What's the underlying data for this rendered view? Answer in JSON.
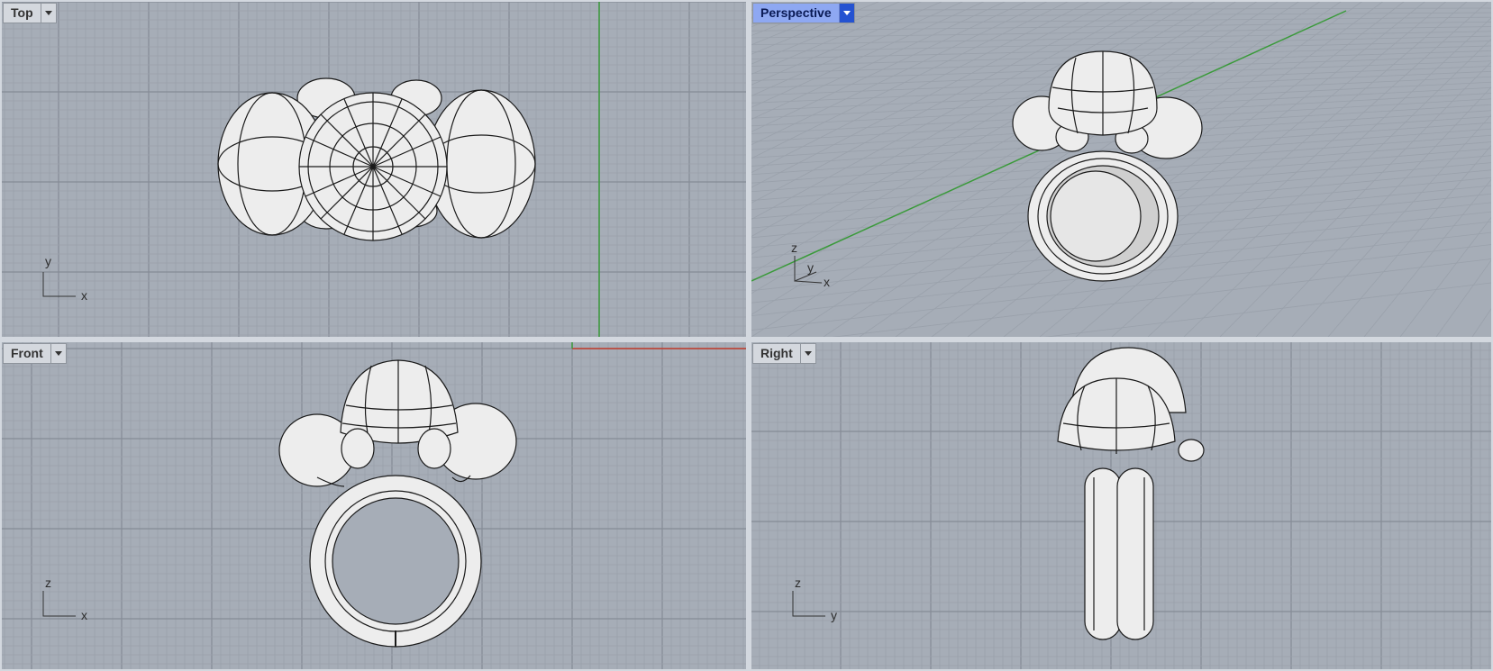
{
  "viewports": {
    "top": {
      "title": "Top",
      "axis_h": "x",
      "axis_v": "y",
      "active": false
    },
    "perspective": {
      "title": "Perspective",
      "axis_h": "x",
      "axis_v": "z",
      "axis_d": "y",
      "active": true
    },
    "front": {
      "title": "Front",
      "axis_h": "x",
      "axis_v": "z",
      "active": false
    },
    "right": {
      "title": "Right",
      "axis_h": "y",
      "axis_v": "z",
      "active": false
    }
  },
  "colors": {
    "background": "#a6adb7",
    "grid_minor": "#9aa1ab",
    "grid_major": "#858c96",
    "x_axis": "#c23b2b",
    "y_axis": "#3a9a3a",
    "model_fill": "#eeeeee",
    "model_wire": "#1a1a1a",
    "active_tab": "#8ea8f2"
  },
  "icons": {
    "menu": "chevron-down-icon",
    "axes": "axis-triad-icon",
    "model": "ring-model"
  }
}
